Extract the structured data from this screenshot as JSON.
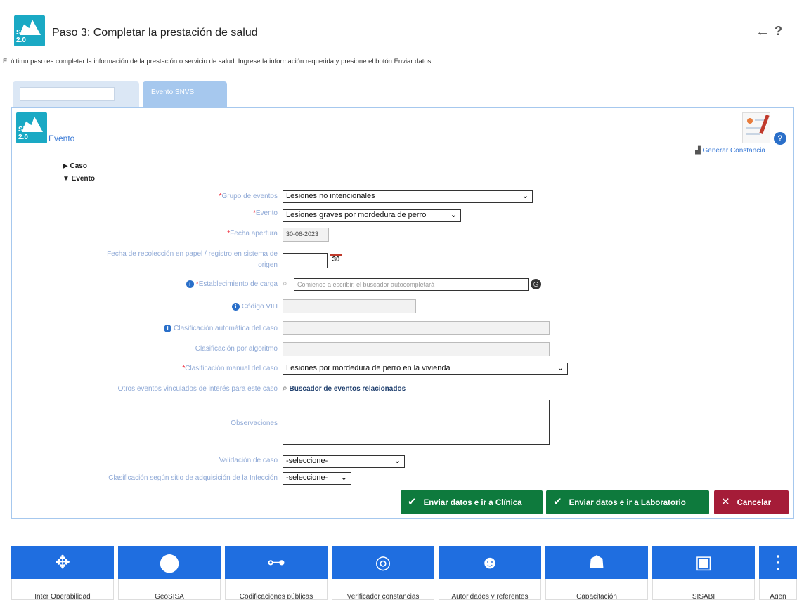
{
  "header": {
    "title": "Paso 3: Completar la prestación de salud",
    "logo_text": "SNVS 2.0",
    "back": "←",
    "help": "?"
  },
  "intro": "El último paso es completar la información de la prestación o servicio de salud. Ingrese la información requerida y presione el botón Enviar datos.",
  "tabs": [
    {
      "label": ""
    },
    {
      "label": "Evento SNVS"
    }
  ],
  "section": {
    "title": "Evento",
    "logo_text": "SNVS 2.0",
    "generate": "Generar Constancia",
    "help": "?"
  },
  "tree": {
    "caso": "▶ Caso",
    "evento": "▼ Evento"
  },
  "form": {
    "grupo_label": "Grupo de eventos",
    "grupo_value": "Lesiones no intencionales",
    "evento_label": "Evento",
    "evento_value": "Lesiones graves por mordedura de perro",
    "fecha_apertura_label": "Fecha apertura",
    "fecha_apertura_value": "30-06-2023",
    "fecha_recoleccion_label_1": "Fecha de recolección en papel / registro en sistema de",
    "fecha_recoleccion_label_2": "origen",
    "calendar_day": "30",
    "establecimiento_label": "Establecimiento de carga",
    "establecimiento_placeholder": "Comience a escribir, el buscador autocompletará",
    "codigo_vih_label": "Código VIH",
    "clasif_auto_label": "Clasificación automática del caso",
    "clasif_algoritmo_label": "Clasificación por algoritmo",
    "clasif_manual_label": "Clasificación manual del caso",
    "clasif_manual_value": "Lesiones por mordedura de perro en la vivienda",
    "otros_label": "Otros eventos vinculados de interés para este caso",
    "otros_link": "Buscador de eventos relacionados",
    "observaciones_label": "Observaciones",
    "validacion_label": "Validación de caso",
    "validacion_value": "-seleccione-",
    "sitio_label": "Clasificación según sitio de adquisición de la Infección",
    "sitio_value": "-seleccione-",
    "required_mark": "*"
  },
  "buttons": {
    "clinica": "Enviar datos e ir a Clínica",
    "laboratorio": "Enviar datos e ir a Laboratorio",
    "cancelar": "Cancelar"
  },
  "tiles": [
    {
      "label": "Inter Operabilidad",
      "icon": "puzzle-icon"
    },
    {
      "label": "GeoSISA",
      "icon": "map-pin-icon"
    },
    {
      "label": "Codificaciones públicas",
      "icon": "tree-icon"
    },
    {
      "label": "Verificador constancias",
      "icon": "barcode-search-icon"
    },
    {
      "label": "Autoridades y referentes",
      "icon": "people-icon"
    },
    {
      "label": "Capacitación",
      "icon": "graduate-icon"
    },
    {
      "label": "SISABI",
      "icon": "monitor-chart-icon"
    },
    {
      "label": "Agen",
      "icon": "more-icon"
    }
  ],
  "colors": {
    "accent": "#1f6ee0",
    "green": "#0e7a3d",
    "red": "#a51c38",
    "label": "#8fa9d6"
  }
}
